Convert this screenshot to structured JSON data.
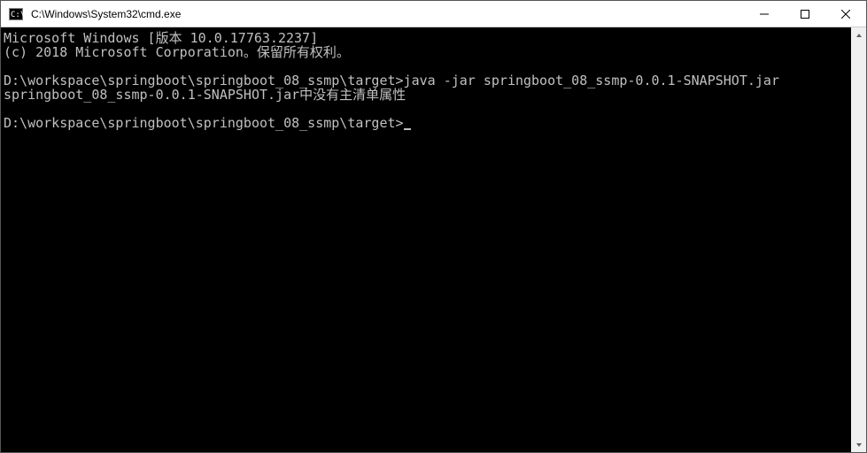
{
  "titlebar": {
    "icon_text": "C:\\",
    "title": "C:\\Windows\\System32\\cmd.exe"
  },
  "terminal": {
    "line1": "Microsoft Windows [版本 10.0.17763.2237]",
    "line2": "(c) 2018 Microsoft Corporation。保留所有权利。",
    "line3": "",
    "line4": "D:\\workspace\\springboot\\springboot_08_ssmp\\target>java -jar springboot_08_ssmp-0.0.1-SNAPSHOT.jar",
    "line5": "springboot_08_ssmp-0.0.1-SNAPSHOT.jar中没有主清单属性",
    "line6": "",
    "line7": "D:\\workspace\\springboot\\springboot_08_ssmp\\target>"
  }
}
